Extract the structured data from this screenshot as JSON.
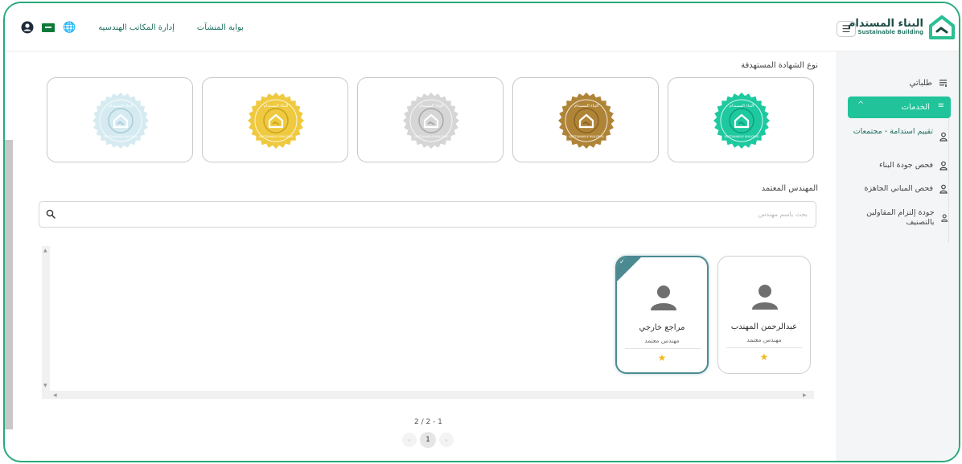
{
  "header": {
    "brand_ar": "البناء المستدام",
    "brand_en": "Sustainable Building",
    "link_portal": "بوابة المنشآت",
    "link_offices": "إدارة المكاتب الهندسيه",
    "icons": [
      "user-icon",
      "saudi-flag-icon",
      "globe-icon",
      "menu-icon"
    ]
  },
  "sidebar": {
    "my_requests": "طلباتي",
    "services": "الخدمات",
    "items": [
      "تقييم استدامة - مجتمعات",
      "فحص جودة البناء",
      "فحص المباني الجاهزة",
      "جودة إلتزام المقاولين بالتصنيف"
    ]
  },
  "certificate": {
    "label": "نوع الشهادة المستهدفة",
    "badge_text_ar": "البناء المستدام",
    "badge_text_en": "SUSTAINABLE BUILDING",
    "levels": [
      {
        "color": "#1ec9a0",
        "accent": "#0f9f7d"
      },
      {
        "color": "#b08437",
        "accent": "#8a6324"
      },
      {
        "color": "#d6d6d6",
        "accent": "#a8a8a8"
      },
      {
        "color": "#efc93f",
        "accent": "#c9a41e"
      },
      {
        "color": "#d5ebf1",
        "accent": "#a9cbd6"
      }
    ]
  },
  "engineer": {
    "label": "المهندس المعتمد",
    "search_placeholder": "بحث باسم مهندس",
    "cards": [
      {
        "name": "عبدالرحمن المهندب",
        "role": "مهندس معتمد",
        "selected": false
      },
      {
        "name": "مراجع خارجي",
        "role": "مهندس معتمد",
        "selected": true
      }
    ]
  },
  "pagination": {
    "summary": "2 / 2 - 1",
    "current": "1",
    "prev": "‹",
    "next": "›"
  },
  "colors": {
    "brand": "#20c39a",
    "frame": "#2aa979",
    "selected_card": "#4c8a91",
    "star": "#f1b81f"
  }
}
